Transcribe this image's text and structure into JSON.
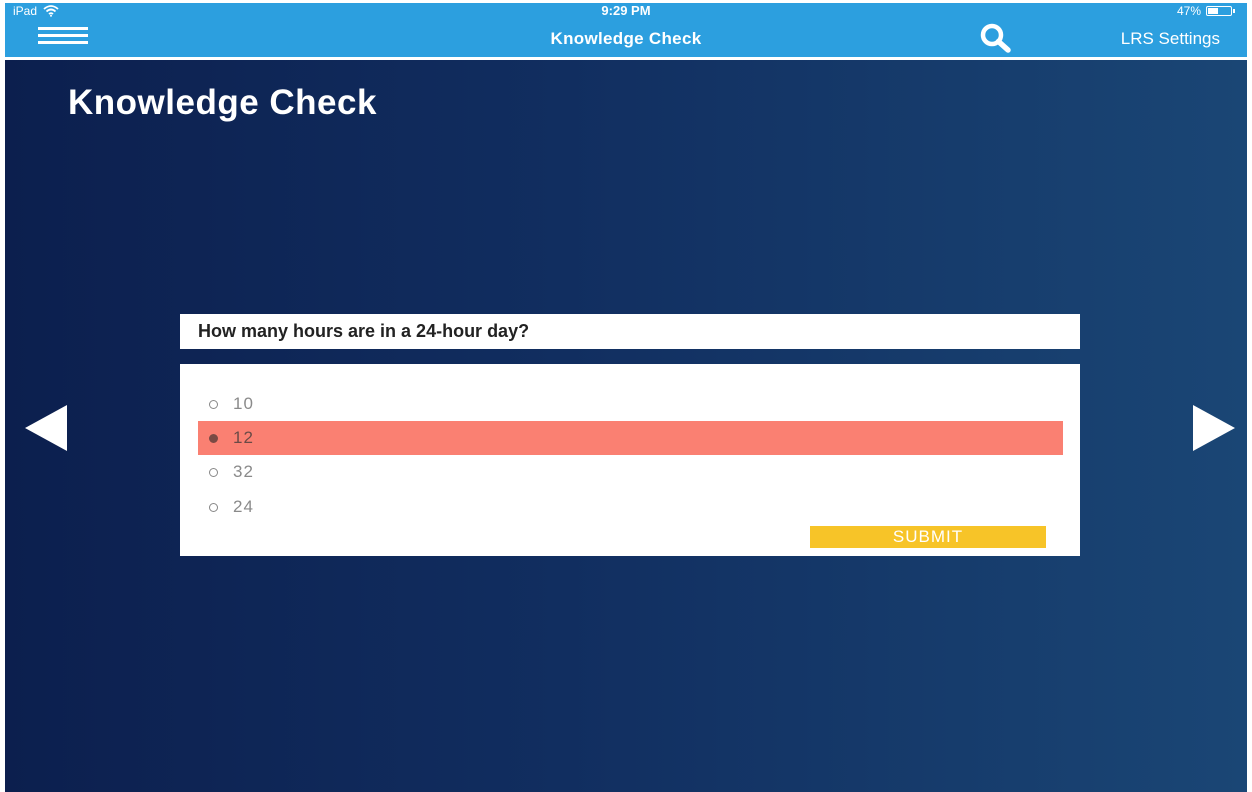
{
  "status_bar": {
    "device": "iPad",
    "wifi_icon": "wifi-icon",
    "time": "9:29 PM",
    "battery_percent": "47%",
    "battery_level": 0.47
  },
  "nav": {
    "menu_icon": "hamburger-menu-icon",
    "title": "Knowledge Check",
    "search_icon": "search-icon",
    "settings_label": "LRS Settings"
  },
  "page": {
    "heading": "Knowledge Check",
    "prev_icon": "triangle-left-icon",
    "next_icon": "triangle-right-icon"
  },
  "quiz": {
    "question": "How many hours are in a 24-hour day?",
    "options": [
      {
        "label": "10",
        "selected": false
      },
      {
        "label": "12",
        "selected": true
      },
      {
        "label": "32",
        "selected": false
      },
      {
        "label": "24",
        "selected": false
      }
    ],
    "submit_label": "SUBMIT"
  },
  "colors": {
    "nav_bar": "#2c9fdf",
    "background_dark": "#0c1f4e",
    "background_light": "#1a4675",
    "selected_option": "#fa8072",
    "submit_button": "#f7c428"
  }
}
